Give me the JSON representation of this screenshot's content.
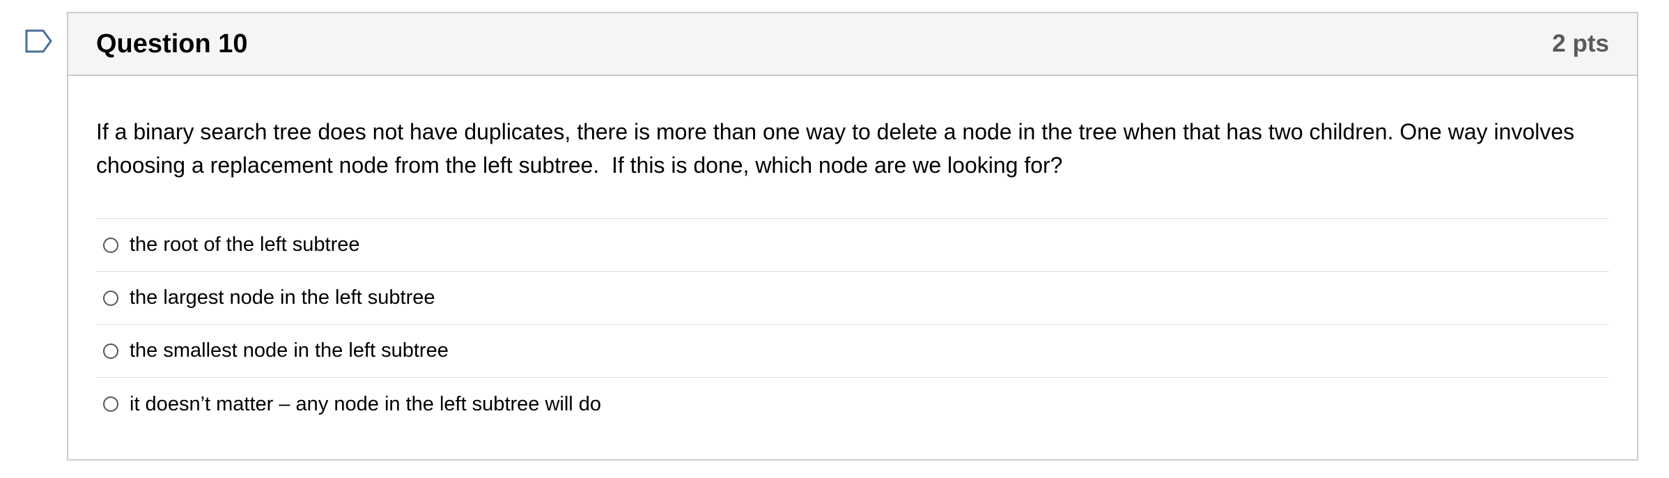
{
  "question": {
    "title": "Question 10",
    "points": "2 pts",
    "text": "If a binary search tree does not have duplicates, there is more than one way to delete a node in the tree when that has two children. One way involves choosing a replacement node from the left subtree.  If this is done, which node are we looking for?",
    "answers": [
      {
        "label": "the root of the left subtree"
      },
      {
        "label": "the largest node in the left subtree"
      },
      {
        "label": "the smallest node in the left subtree"
      },
      {
        "label": "it doesn’t matter – any node in the left subtree will do"
      }
    ]
  },
  "icons": {
    "flag": "flag-question-icon"
  },
  "colors": {
    "flag_outline": "#4a6f9a",
    "header_bg": "#f5f5f5",
    "card_border": "#c7cdd1",
    "points_text": "#5a5a5a"
  }
}
